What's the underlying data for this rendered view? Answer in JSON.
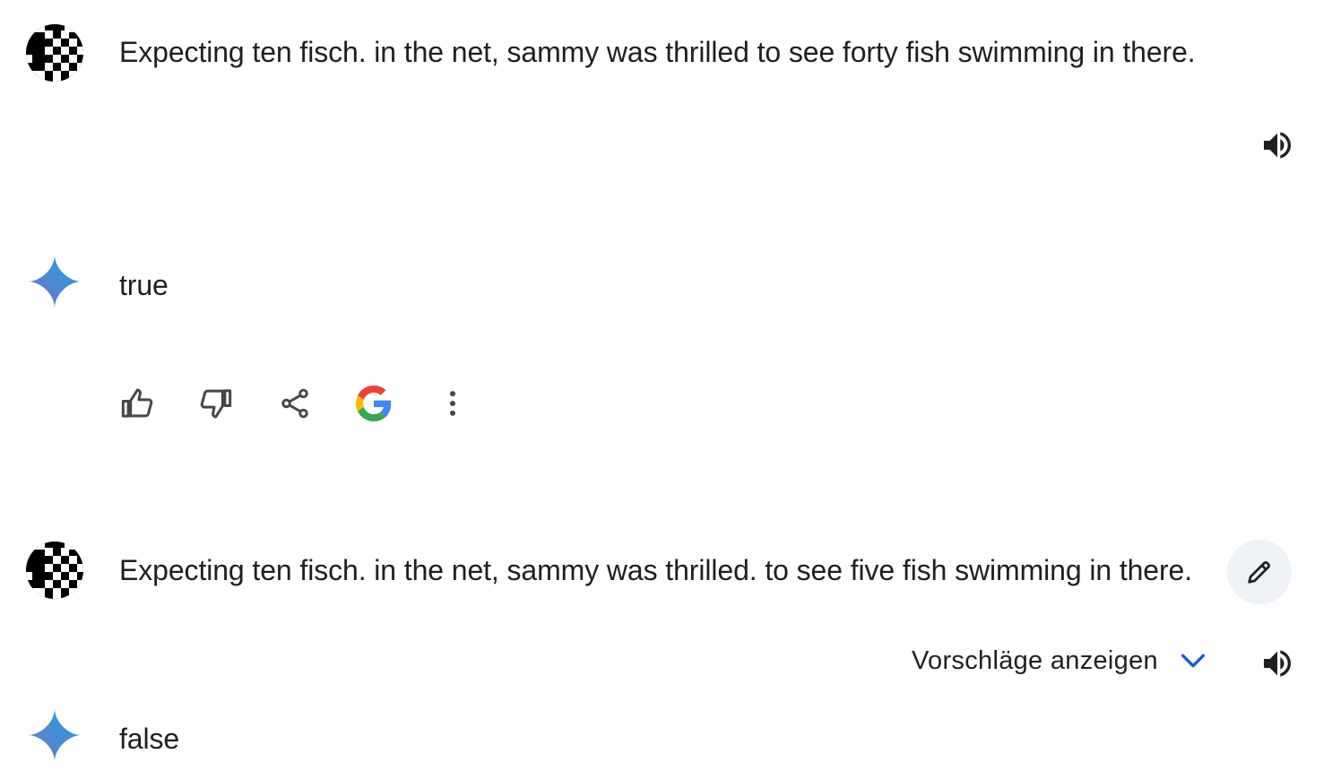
{
  "conversation": {
    "turns": [
      {
        "role": "user",
        "text": "Expecting ten fisch. in the net, sammy was thrilled to see forty fish swimming in there."
      },
      {
        "role": "assistant",
        "text": "true"
      },
      {
        "role": "user",
        "text": "Expecting ten fisch. in the net, sammy was thrilled. to see five fish swimming in there."
      },
      {
        "role": "assistant",
        "text": "false"
      }
    ],
    "show_suggestions_label": "Vorschläge anzeigen"
  },
  "icons": {
    "user_avatar": "checker-avatar-icon",
    "assistant_avatar": "sparkle-icon",
    "speaker": "speaker-icon",
    "thumbs_up": "thumbs-up-icon",
    "thumbs_down": "thumbs-down-icon",
    "share": "share-icon",
    "google": "google-g-icon",
    "more": "more-vert-icon",
    "edit": "pencil-icon",
    "chevron": "chevron-down-icon"
  },
  "colors": {
    "text": "#1f1f1f",
    "accent_blue": "#1a5cd8",
    "edit_bg": "#eef1f6",
    "google_blue": "#4285F4",
    "google_red": "#EA4335",
    "google_yellow": "#FBBC05",
    "google_green": "#34A853"
  }
}
